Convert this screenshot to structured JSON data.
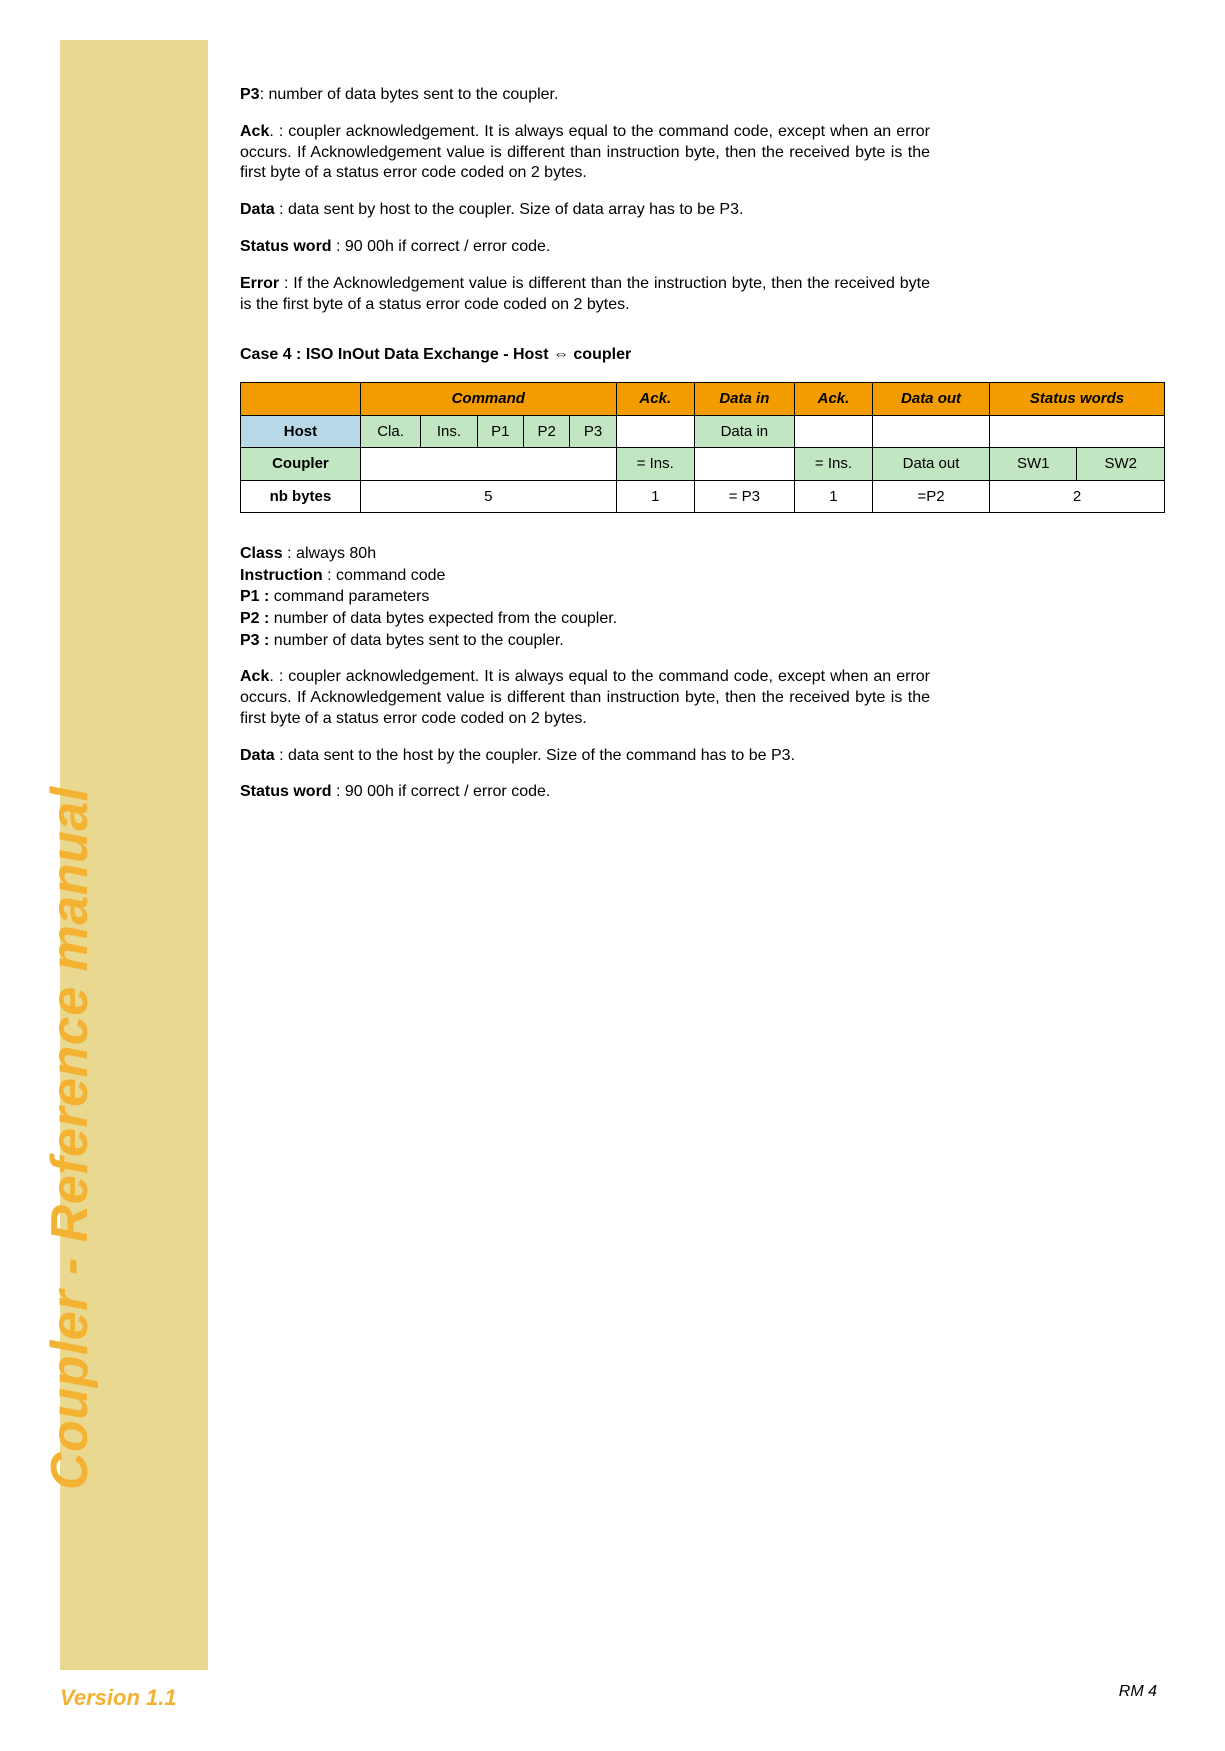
{
  "sidebar": {
    "title": "Coupler - Reference manual",
    "version": "Version 1.1"
  },
  "page_num": "RM 4",
  "top": {
    "p3_label": "P3",
    "p3_text": ": number of data bytes sent to the coupler.",
    "ack_label": "Ack",
    "ack_text": ". : coupler acknowledgement. It is always equal to the command code, except when an error occurs. If Acknowledgement value is different than instruction byte, then the received byte is the first byte of a status error code coded on 2 bytes.",
    "data_label": "Data",
    "data_text": " : data sent by host to the coupler. Size of data array has to be P3.",
    "sw_label": "Status word",
    "sw_text": " : 90 00h if correct / error code.",
    "err_label": "Error",
    "err_text": " : If the Acknowledgement value is different than the instruction byte, then the received byte is the first byte of a status error code coded on 2 bytes."
  },
  "case_heading": "Case 4 : ISO InOut Data Exchange - Host ⇔ coupler",
  "table": {
    "h_command": "Command",
    "h_ack1": "Ack.",
    "h_datain": "Data in",
    "h_ack2": "Ack.",
    "h_dataout": "Data out",
    "h_status": "Status words",
    "r_host": "Host",
    "r_cla": "Cla.",
    "r_ins": "Ins.",
    "r_p1": "P1",
    "r_p2": "P2",
    "r_p3": "P3",
    "r_datain": "Data in",
    "r_coupler": "Coupler",
    "r_eqins1": "= Ins.",
    "r_eqins2": "= Ins.",
    "r_dataout": "Data out",
    "r_sw1": "SW1",
    "r_sw2": "SW2",
    "r_nb": "nb bytes",
    "r_5": "5",
    "r_1a": "1",
    "r_eqp3": "= P3",
    "r_1b": "1",
    "r_eqp2": "=P2",
    "r_2": "2"
  },
  "defs": {
    "class_l": "Class",
    "class_t": " : always 80h",
    "instr_l": "Instruction",
    "instr_t": " : command code",
    "p1_l": "P1 :",
    "p1_t": " command parameters",
    "p2_l": "P2 :",
    "p2_t": " number of data bytes expected from the coupler.",
    "p3_l": "P3 :",
    "p3_t": " number of data bytes sent to the coupler."
  },
  "bottom": {
    "ack_label": "Ack",
    "ack_text": ". : coupler acknowledgement. It is always equal to the command code, except when an error occurs. If Acknowledgement value is different than instruction byte, then the received byte is the first byte of a status error code coded on 2 bytes.",
    "data_label": "Data",
    "data_text": " : data sent to the host by the coupler. Size of the command has to be P3.",
    "sw_label": "Status word",
    "sw_text": " : 90 00h if correct / error code."
  }
}
